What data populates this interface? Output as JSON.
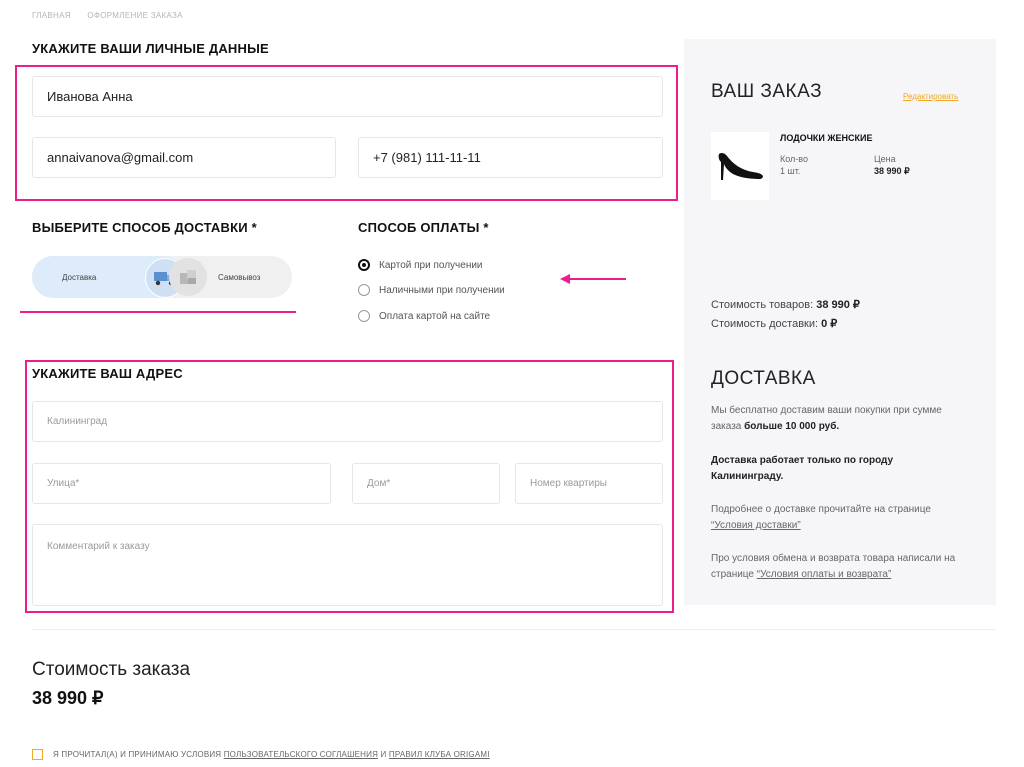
{
  "breadcrumbs": [
    "ГЛАВНАЯ",
    "ОФОРМЛЕНИЕ ЗАКАЗА"
  ],
  "personal": {
    "title": "УКАЖИТЕ ВАШИ ЛИЧНЫЕ ДАННЫЕ",
    "name": "Иванова Анна",
    "email": "annaivanova@gmail.com",
    "phone": "+7 (981) 111-11-11"
  },
  "delivery_method": {
    "title": "ВЫБЕРИТЕ СПОСОБ ДОСТАВКИ *",
    "options": [
      "Доставка",
      "Самовывоз"
    ],
    "selected": "Доставка"
  },
  "payment": {
    "title": "СПОСОБ ОПЛАТЫ *",
    "options": [
      "Картой при получении",
      "Наличными при получении",
      "Оплата картой на сайте"
    ],
    "selected": "Картой при получении"
  },
  "address": {
    "title": "УКАЖИТЕ ВАШ АДРЕС",
    "city": "Калининград",
    "street_placeholder": "Улица*",
    "house_placeholder": "Дом*",
    "apartment_placeholder": "Номер квартиры",
    "comment_placeholder": "Комментарий к заказу"
  },
  "order": {
    "title": "ВАШ ЗАКАЗ",
    "edit_link": "Редактировать",
    "item": {
      "name": "ЛОДОЧКИ ЖЕНСКИЕ",
      "qty_label": "Кол-во",
      "qty": "1 шт.",
      "price_label": "Цена",
      "price": "38 990 ₽"
    },
    "goods_cost_label": "Стоимость товаров:",
    "goods_cost": "38 990 ₽",
    "delivery_cost_label": "Стоимость доставки:",
    "delivery_cost": "0 ₽"
  },
  "delivery_info": {
    "title": "ДОСТАВКА",
    "p1_text": "Мы бесплатно доставим ваши покупки при сумме заказа",
    "p1_bold": "больше 10 000 руб.",
    "p2": "Доставка работает только по городу Калининграду.",
    "p3_text": "Подробнее о доставке прочитайте на странице",
    "p3_link": "“Условия доставки”",
    "p4_text": "Про условия обмена и возврата товара написали на странице",
    "p4_link": "“Условия оплаты и возврата”"
  },
  "total": {
    "label": "Стоимость заказа",
    "value": "38 990 ₽"
  },
  "agreement": {
    "text_prefix": "Я ПРОЧИТАЛ(А) И ПРИНИМАЮ УСЛОВИЯ",
    "link1": "ПОЛЬЗОВАТЕЛЬСКОГО СОГЛАШЕНИЯ",
    "and": "И",
    "link2": "ПРАВИЛ КЛУБА ORIGAMI"
  },
  "colors": {
    "highlight": "#ec1e8e",
    "accent_orange": "#f5a623",
    "toggle_active": "#deebfb",
    "panel_bg": "#f6f6f8"
  }
}
